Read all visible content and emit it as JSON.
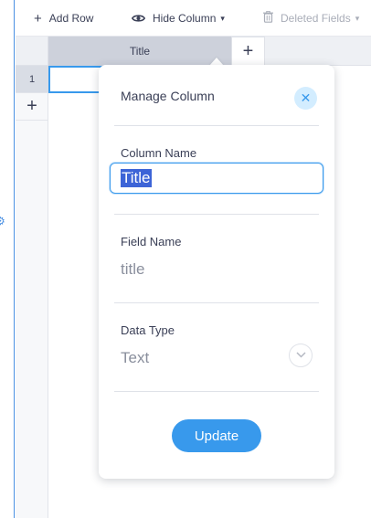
{
  "toolbar": {
    "add_row_label": "Add Row",
    "hide_column_label": "Hide Column",
    "deleted_fields_label": "Deleted Fields"
  },
  "grid": {
    "column_header": "Title",
    "row_number": "1"
  },
  "popup": {
    "title": "Manage Column",
    "column_name_label": "Column Name",
    "column_name_value": "Title",
    "field_name_label": "Field Name",
    "field_name_value": "title",
    "data_type_label": "Data Type",
    "data_type_value": "Text",
    "update_label": "Update"
  },
  "icons": {
    "plus": "plus-icon",
    "eye": "eye-icon",
    "trash": "trash-icon",
    "close": "close-icon",
    "chevron_down": "chevron-down-icon",
    "gear": "gear-icon"
  },
  "colors": {
    "accent": "#3899ec",
    "close_bg": "#d3edff",
    "selection": "#3d64d7",
    "header_active": "#cdd1db"
  }
}
